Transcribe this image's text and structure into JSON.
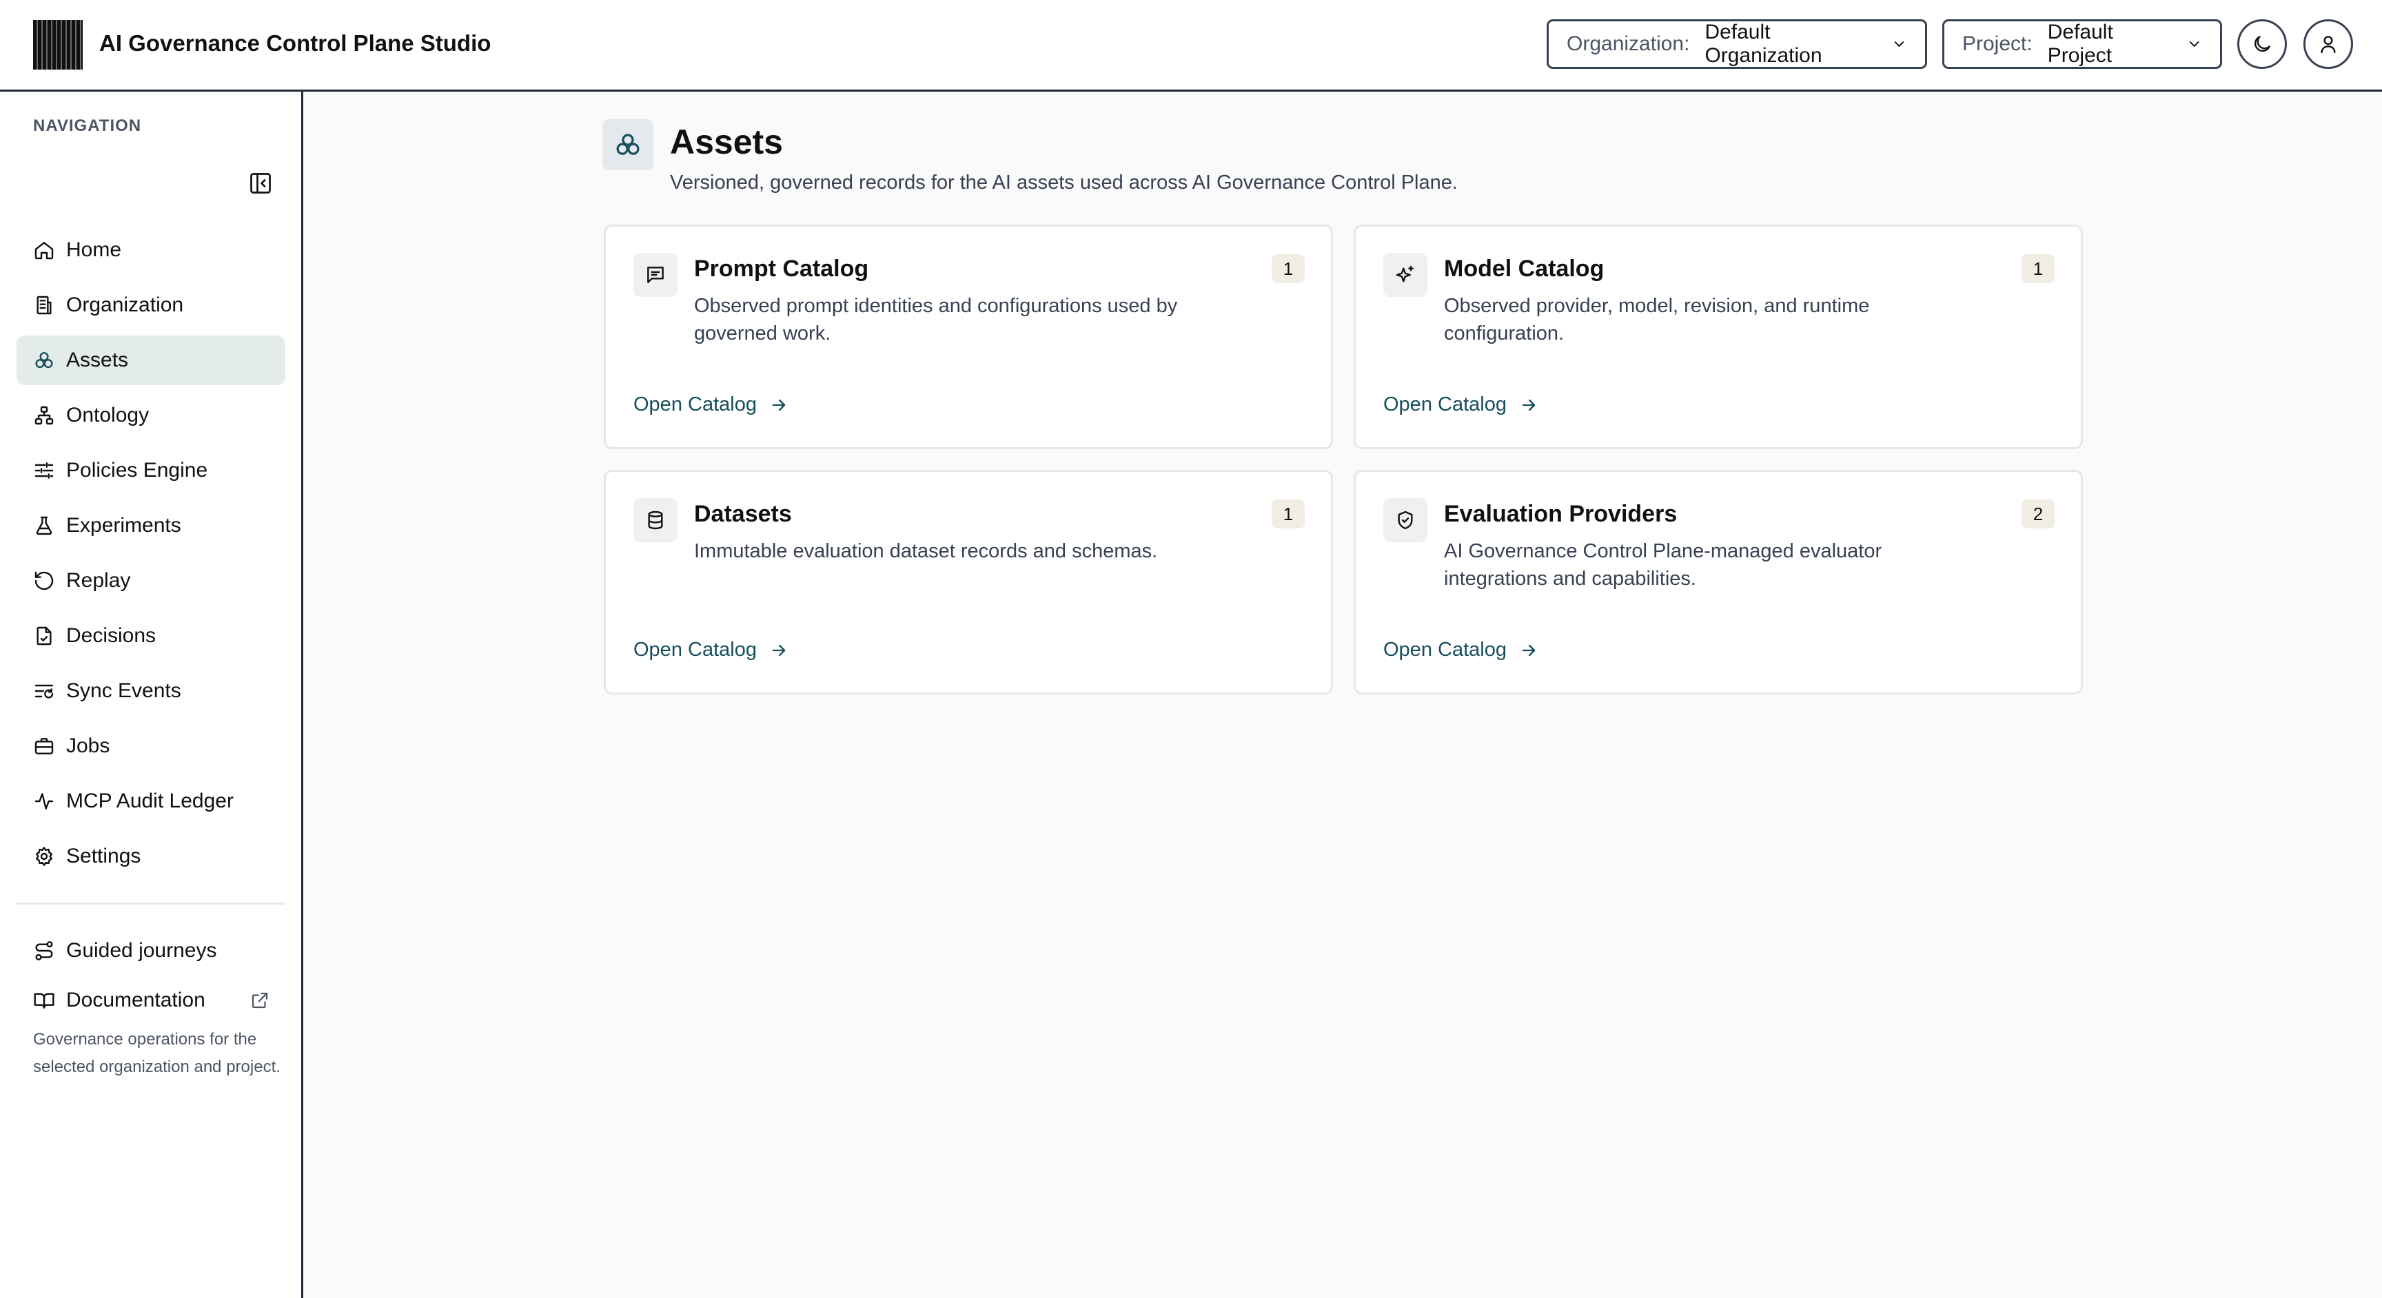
{
  "header": {
    "app_title": "AI Governance Control Plane Studio",
    "organization": {
      "label": "Organization:",
      "value": "Default Organization"
    },
    "project": {
      "label": "Project:",
      "value": "Default Project"
    }
  },
  "sidebar": {
    "heading": "NAVIGATION",
    "items": [
      {
        "label": "Home",
        "icon": "home-icon"
      },
      {
        "label": "Organization",
        "icon": "building-icon"
      },
      {
        "label": "Assets",
        "icon": "assets-icon",
        "active": true
      },
      {
        "label": "Ontology",
        "icon": "hierarchy-icon"
      },
      {
        "label": "Policies Engine",
        "icon": "sliders-icon"
      },
      {
        "label": "Experiments",
        "icon": "flask-icon"
      },
      {
        "label": "Replay",
        "icon": "replay-icon"
      },
      {
        "label": "Decisions",
        "icon": "document-icon"
      },
      {
        "label": "Sync Events",
        "icon": "sync-list-icon"
      },
      {
        "label": "Jobs",
        "icon": "briefcase-icon"
      },
      {
        "label": "MCP Audit Ledger",
        "icon": "activity-icon"
      },
      {
        "label": "Settings",
        "icon": "gear-icon"
      }
    ],
    "footer_items": [
      {
        "label": "Guided journeys",
        "icon": "route-icon"
      },
      {
        "label": "Documentation",
        "icon": "book-icon"
      }
    ],
    "note": "Governance operations for the selected organization and project."
  },
  "main": {
    "title": "Assets",
    "subtitle": "Versioned, governed records for the AI assets used across AI Governance Control Plane.",
    "cards": [
      {
        "title": "Prompt Catalog",
        "description": "Observed prompt identities and configurations used by governed work.",
        "count": "1",
        "link": "Open Catalog",
        "icon": "message-icon"
      },
      {
        "title": "Model Catalog",
        "description": "Observed provider, model, revision, and runtime configuration.",
        "count": "1",
        "link": "Open Catalog",
        "icon": "sparkles-icon"
      },
      {
        "title": "Datasets",
        "description": "Immutable evaluation dataset records and schemas.",
        "count": "1",
        "link": "Open Catalog",
        "icon": "database-icon"
      },
      {
        "title": "Evaluation Providers",
        "description": "AI Governance Control Plane-managed evaluator integrations and capabilities.",
        "count": "2",
        "link": "Open Catalog",
        "icon": "shield-check-icon"
      }
    ]
  },
  "colors": {
    "accent_link": "#164e5c",
    "active_nav_bg": "#e3ece9",
    "badge_bg": "#f1ede3"
  }
}
